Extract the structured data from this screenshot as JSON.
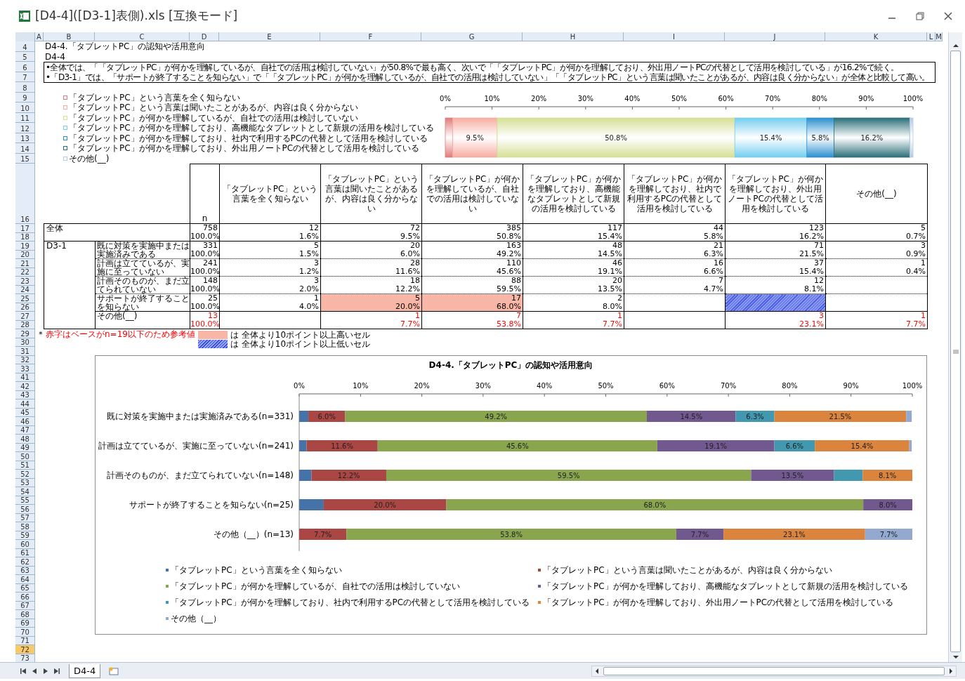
{
  "window": {
    "title": "[D4-4]([D3-1]表側).xls [互換モード]"
  },
  "column_headers": [
    "A",
    "B",
    "C",
    "D",
    "E",
    "F",
    "G",
    "H",
    "I",
    "J",
    "K",
    "L",
    "M"
  ],
  "row_headers": [
    {
      "label": "4",
      "selected": false
    },
    {
      "label": "5",
      "selected": false
    },
    {
      "label": "6",
      "selected": false
    },
    {
      "label": "7",
      "selected": false
    },
    {
      "label": "8",
      "selected": false
    },
    {
      "label": "9",
      "selected": false
    },
    {
      "label": "10",
      "selected": false
    },
    {
      "label": "11",
      "selected": false
    },
    {
      "label": "12",
      "selected": false
    },
    {
      "label": "13",
      "selected": false
    },
    {
      "label": "14",
      "selected": false
    },
    {
      "label": "15",
      "selected": false
    },
    {
      "label": "16",
      "selected": false
    },
    {
      "label": "17",
      "selected": false
    },
    {
      "label": "18",
      "selected": false
    },
    {
      "label": "19",
      "selected": false
    },
    {
      "label": "20",
      "selected": false
    },
    {
      "label": "21",
      "selected": false
    },
    {
      "label": "22",
      "selected": false
    },
    {
      "label": "23",
      "selected": false
    },
    {
      "label": "24",
      "selected": false
    },
    {
      "label": "25",
      "selected": false
    },
    {
      "label": "26",
      "selected": false
    },
    {
      "label": "27",
      "selected": false
    },
    {
      "label": "28",
      "selected": false
    },
    {
      "label": "29",
      "selected": false
    },
    {
      "label": "30",
      "selected": false
    },
    {
      "label": "31",
      "selected": false
    },
    {
      "label": "32",
      "selected": false
    },
    {
      "label": "33",
      "selected": false
    },
    {
      "label": "41",
      "selected": false
    },
    {
      "label": "42",
      "selected": false
    },
    {
      "label": "43",
      "selected": false
    },
    {
      "label": "44",
      "selected": false
    },
    {
      "label": "45",
      "selected": false
    },
    {
      "label": "46",
      "selected": false
    },
    {
      "label": "47",
      "selected": false
    },
    {
      "label": "48",
      "selected": false
    },
    {
      "label": "49",
      "selected": false
    },
    {
      "label": "50",
      "selected": false
    },
    {
      "label": "51",
      "selected": false
    },
    {
      "label": "52",
      "selected": false
    },
    {
      "label": "53",
      "selected": false
    },
    {
      "label": "54",
      "selected": false
    },
    {
      "label": "55",
      "selected": false
    },
    {
      "label": "56",
      "selected": false
    },
    {
      "label": "57",
      "selected": false
    },
    {
      "label": "58",
      "selected": false
    },
    {
      "label": "59",
      "selected": false
    },
    {
      "label": "60",
      "selected": false
    },
    {
      "label": "61",
      "selected": false
    },
    {
      "label": "62",
      "selected": false
    },
    {
      "label": "63",
      "selected": false
    },
    {
      "label": "64",
      "selected": false
    },
    {
      "label": "65",
      "selected": false
    },
    {
      "label": "66",
      "selected": false
    },
    {
      "label": "67",
      "selected": false
    },
    {
      "label": "68",
      "selected": false
    },
    {
      "label": "69",
      "selected": false
    },
    {
      "label": "70",
      "selected": false
    },
    {
      "label": "71",
      "selected": false
    },
    {
      "label": "72",
      "selected": true
    },
    {
      "label": "73",
      "selected": false
    }
  ],
  "sheet": {
    "title": "D4-4.「タブレットPC」の認知や活用意向",
    "subtitle": "D4-4",
    "summary": [
      "•全体では、「「タブレットPC」が何かを理解しているが、自社での活用は検討していない」が50.8%で最も高く、次いで「「タブレットPC」が何かを理解しており、外出用ノートPCの代替として活用を検討している」が16.2%で続く。",
      "•「D3-1」では、「サポートが終了することを知らない」で「「タブレットPC」が何かを理解しているが、自社での活用は検討していない」「「タブレットPC」という言葉は聞いたことがあるが、内容は良く分からない」が全体と比較して高い。"
    ],
    "overview_chart": {
      "chart_data": {
        "type": "bar",
        "orientation": "horizontal",
        "stacked": true,
        "legend": "left",
        "xlim": [
          0,
          100
        ],
        "xticks": [
          {
            "value": 0,
            "label": "0%"
          },
          {
            "value": 10,
            "label": "10%"
          },
          {
            "value": 20,
            "label": "20%"
          },
          {
            "value": 30,
            "label": "30%"
          },
          {
            "value": 40,
            "label": "40%"
          },
          {
            "value": 50,
            "label": "50%"
          },
          {
            "value": 60,
            "label": "60%"
          },
          {
            "value": 70,
            "label": "70%"
          },
          {
            "value": 80,
            "label": "80%"
          },
          {
            "value": 90,
            "label": "90%"
          },
          {
            "value": 100,
            "label": "100%"
          }
        ],
        "data_labels": "value_labels",
        "series": [
          {
            "name": "「タブレットPC」という言葉を全く知らない",
            "color": "#e07b7b",
            "values": [
              1.6
            ]
          },
          {
            "name": "「タブレットPC」という言葉は聞いたことがあるが、内容は良く分からない",
            "color": "#f7ada2",
            "values": [
              9.5
            ],
            "value_labels": [
              "9.5%"
            ]
          },
          {
            "name": "「タブレットPC」が何かを理解しているが、自社での活用は検討していない",
            "color": "#d6df95",
            "values": [
              50.8
            ],
            "value_labels": [
              "50.8%"
            ]
          },
          {
            "name": "「タブレットPC」が何かを理解しており、高機能なタブレットとして新規の活用を検討している",
            "color": "#74cdef",
            "values": [
              15.4
            ],
            "value_labels": [
              "15.4%"
            ]
          },
          {
            "name": "「タブレットPC」が何かを理解しており、社内で利用するPCの代替として活用を検討している",
            "color": "#2b8fcf",
            "values": [
              5.8
            ],
            "value_labels": [
              "5.8%"
            ]
          },
          {
            "name": "「タブレットPC」が何かを理解しており、外出用ノートPCの代替として活用を検討している",
            "color": "#2b6f78",
            "values": [
              16.2
            ],
            "value_labels": [
              "16.2%"
            ]
          },
          {
            "name": "その他(__)",
            "color": "#b7cbe3",
            "values": [
              0.7
            ]
          }
        ]
      }
    },
    "table": {
      "columns": [
        "n",
        "「タブレットPC」という言葉を全く知らない",
        "「タブレットPC」という言葉は聞いたことがあるが、内容は良く分からない",
        "「タブレットPC」が何かを理解しているが、自社での活用は検討していない",
        "「タブレットPC」が何かを理解しており、高機能なタブレットとして新規の活用を検討している",
        "「タブレットPC」が何かを理解しており、社内で利用するPCの代替として活用を検討している",
        "「タブレットPC」が何かを理解しており、外出用ノートPCの代替として活用を検討している",
        "その他(__)"
      ],
      "total": {
        "label": "全体",
        "small_base": false,
        "n": {
          "count": "758",
          "pct": "100.0%"
        },
        "cells": [
          {
            "count": "12",
            "pct": "1.6%"
          },
          {
            "count": "72",
            "pct": "9.5%"
          },
          {
            "count": "385",
            "pct": "50.8%"
          },
          {
            "count": "117",
            "pct": "15.4%"
          },
          {
            "count": "44",
            "pct": "5.8%"
          },
          {
            "count": "123",
            "pct": "16.2%"
          },
          {
            "count": "5",
            "pct": "0.7%"
          }
        ]
      },
      "groups": [
        {
          "label": "D3-1",
          "rows": [
            {
              "label": "既に対策を実施中または実施済みである",
              "small_base": false,
              "n": {
                "count": "331",
                "pct": "100.0%"
              },
              "cells": [
                {
                  "kind": "plain",
                  "count": "5",
                  "pct": "1.5%"
                },
                {
                  "kind": "plain",
                  "count": "20",
                  "pct": "6.0%"
                },
                {
                  "kind": "plain",
                  "count": "163",
                  "pct": "49.2%"
                },
                {
                  "kind": "plain",
                  "count": "48",
                  "pct": "14.5%"
                },
                {
                  "kind": "plain",
                  "count": "21",
                  "pct": "6.3%"
                },
                {
                  "kind": "plain",
                  "count": "71",
                  "pct": "21.5%"
                },
                {
                  "kind": "plain",
                  "count": "3",
                  "pct": "0.9%"
                }
              ]
            },
            {
              "label": "計画は立てているが、実施に至っていない",
              "small_base": false,
              "n": {
                "count": "241",
                "pct": "100.0%"
              },
              "cells": [
                {
                  "kind": "plain",
                  "count": "3",
                  "pct": "1.2%"
                },
                {
                  "kind": "plain",
                  "count": "28",
                  "pct": "11.6%"
                },
                {
                  "kind": "plain",
                  "count": "110",
                  "pct": "45.6%"
                },
                {
                  "kind": "plain",
                  "count": "46",
                  "pct": "19.1%"
                },
                {
                  "kind": "plain",
                  "count": "16",
                  "pct": "6.6%"
                },
                {
                  "kind": "plain",
                  "count": "37",
                  "pct": "15.4%"
                },
                {
                  "kind": "plain",
                  "count": "1",
                  "pct": "0.4%"
                }
              ]
            },
            {
              "label": "計画そのものが、まだ立てられていない",
              "small_base": false,
              "n": {
                "count": "148",
                "pct": "100.0%"
              },
              "cells": [
                {
                  "kind": "plain",
                  "count": "3",
                  "pct": "2.0%"
                },
                {
                  "kind": "plain",
                  "count": "18",
                  "pct": "12.2%"
                },
                {
                  "kind": "plain",
                  "count": "88",
                  "pct": "59.5%"
                },
                {
                  "kind": "plain",
                  "count": "20",
                  "pct": "13.5%"
                },
                {
                  "kind": "plain",
                  "count": "7",
                  "pct": "4.7%"
                },
                {
                  "kind": "plain",
                  "count": "12",
                  "pct": "8.1%"
                },
                {
                  "kind": "plain"
                }
              ]
            },
            {
              "label": "サポートが終了することを知らない",
              "small_base": false,
              "n": {
                "count": "25",
                "pct": "100.0%"
              },
              "cells": [
                {
                  "kind": "plain",
                  "count": "1",
                  "pct": "4.0%"
                },
                {
                  "kind": "high",
                  "count": "5",
                  "pct": "20.0%"
                },
                {
                  "kind": "high",
                  "count": "17",
                  "pct": "68.0%"
                },
                {
                  "kind": "plain",
                  "count": "2",
                  "pct": "8.0%"
                },
                {
                  "kind": "plain"
                },
                {
                  "kind": "low"
                },
                {
                  "kind": "plain"
                }
              ]
            },
            {
              "label": "その他(__)",
              "small_base": true,
              "n": {
                "count": "13",
                "pct": "100.0%"
              },
              "cells": [
                {
                  "kind": "plain"
                },
                {
                  "kind": "plain",
                  "count": "1",
                  "pct": "7.7%"
                },
                {
                  "kind": "plain",
                  "count": "7",
                  "pct": "53.8%"
                },
                {
                  "kind": "plain",
                  "count": "1",
                  "pct": "7.7%"
                },
                {
                  "kind": "plain"
                },
                {
                  "kind": "plain",
                  "count": "3",
                  "pct": "23.1%"
                },
                {
                  "kind": "plain",
                  "count": "1",
                  "pct": "7.7%"
                }
              ]
            }
          ]
        }
      ]
    },
    "notes": {
      "mark": "＊",
      "text": "赤字はベースがn=19以下のため参考値",
      "legend": [
        {
          "kind": "high",
          "text": "は 全体より10ポイント以上高いセル"
        },
        {
          "kind": "low",
          "text": "は 全体より10ポイント以上低いセル"
        }
      ]
    },
    "chart": {
      "chart_data": {
        "type": "bar",
        "title": "D4-4.「タブレットPC」の認知や活用意向",
        "orientation": "horizontal",
        "stacked": true,
        "legend": "bottom",
        "categories": [
          "既に対策を実施中または実施済みである(n=331)",
          "計画は立てているが、実施に至っていない(n=241)",
          "計画そのものが、まだ立てられていない(n=148)",
          "サポートが終了することを知らない(n=25)",
          "その他（__）(n=13)"
        ],
        "xlim": [
          0,
          100
        ],
        "xticks": [
          {
            "value": 0,
            "label": "0%"
          },
          {
            "value": 10,
            "label": "10%"
          },
          {
            "value": 20,
            "label": "20%"
          },
          {
            "value": 30,
            "label": "30%"
          },
          {
            "value": 40,
            "label": "40%"
          },
          {
            "value": 50,
            "label": "50%"
          },
          {
            "value": 60,
            "label": "60%"
          },
          {
            "value": 70,
            "label": "70%"
          },
          {
            "value": 80,
            "label": "80%"
          },
          {
            "value": 90,
            "label": "90%"
          },
          {
            "value": 100,
            "label": "100%"
          }
        ],
        "data_labels": "value_labels",
        "series": [
          {
            "name": "「タブレットPC」という言葉を全く知らない",
            "color": "#4572a7",
            "values": [
              1.5,
              1.2,
              2.0,
              4.0,
              null
            ]
          },
          {
            "name": "「タブレットPC」という言葉は聞いたことがあるが、内容は良く分からない",
            "color": "#aa4643",
            "values": [
              6.0,
              11.6,
              12.2,
              20.0,
              7.7
            ],
            "value_labels": [
              "6.0%",
              "11.6%",
              "12.2%",
              "20.0%",
              "7.7%"
            ]
          },
          {
            "name": "「タブレットPC」が何かを理解しているが、自社での活用は検討していない",
            "color": "#89a54e",
            "values": [
              49.2,
              45.6,
              59.5,
              68.0,
              53.8
            ],
            "value_labels": [
              "49.2%",
              "45.6%",
              "59.5%",
              "68.0%",
              "53.8%"
            ]
          },
          {
            "name": "「タブレットPC」が何かを理解しており、高機能なタブレットとして新規の活用を検討している",
            "color": "#71588f",
            "values": [
              14.5,
              19.1,
              13.5,
              8.0,
              7.7
            ],
            "value_labels": [
              "14.5%",
              "19.1%",
              "13.5%",
              "8.0%",
              "7.7%"
            ]
          },
          {
            "name": "「タブレットPC」が何かを理解しており、社内で利用するPCの代替として活用を検討している",
            "color": "#4198af",
            "values": [
              6.3,
              6.6,
              4.7,
              null,
              null
            ],
            "value_labels": [
              "6.3%",
              "6.6%",
              null,
              null,
              null
            ]
          },
          {
            "name": "「タブレットPC」が何かを理解しており、外出用ノートPCの代替として活用を検討している",
            "color": "#db843d",
            "values": [
              21.5,
              15.4,
              8.1,
              null,
              23.1
            ],
            "value_labels": [
              "21.5%",
              "15.4%",
              "8.1%",
              null,
              "23.1%"
            ]
          },
          {
            "name": "その他（__）",
            "color": "#93a9cf",
            "values": [
              0.9,
              0.4,
              null,
              null,
              7.7
            ],
            "value_labels": [
              null,
              null,
              null,
              null,
              "7.7%"
            ]
          }
        ]
      }
    }
  },
  "sheet_tabs": [
    {
      "label": "D4-4",
      "selected": true
    }
  ]
}
